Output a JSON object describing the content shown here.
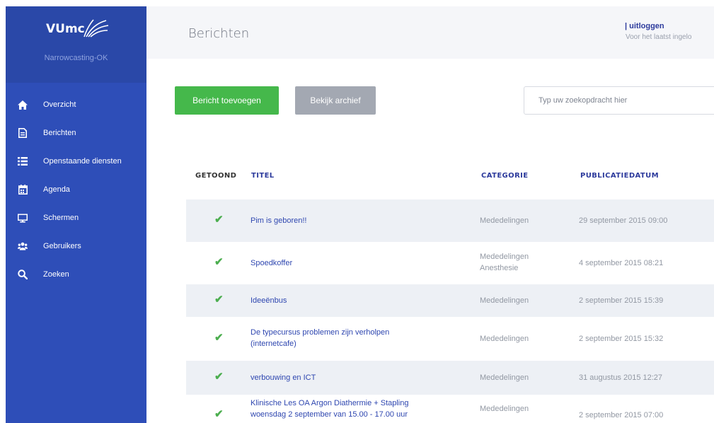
{
  "brand": {
    "logo_text": "VUmc",
    "subtitle": "Narrowcasting-OK"
  },
  "sidebar": {
    "items": [
      {
        "label": "Overzicht",
        "icon": "home-icon"
      },
      {
        "label": "Berichten",
        "icon": "document-icon"
      },
      {
        "label": "Openstaande diensten",
        "icon": "list-icon"
      },
      {
        "label": "Agenda",
        "icon": "calendar-icon"
      },
      {
        "label": "Schermen",
        "icon": "monitor-icon"
      },
      {
        "label": "Gebruikers",
        "icon": "users-icon"
      },
      {
        "label": "Zoeken",
        "icon": "search-icon"
      }
    ]
  },
  "header": {
    "title": "Berichten",
    "logout_label": "| uitloggen",
    "last_login_text": "Voor het laatst ingelo"
  },
  "toolbar": {
    "add_label": "Bericht toevoegen",
    "archive_label": "Bekijk archief",
    "search_placeholder": "Typ uw zoekopdracht hier"
  },
  "table": {
    "columns": {
      "shown": "GETOOND",
      "title": "TITEL",
      "category": "CATEGORIE",
      "date": "PUBLICATIEDATUM"
    },
    "rows": [
      {
        "shown": "✔",
        "title_lines": [
          "Pim is geboren!!"
        ],
        "category_lines": [
          "Mededelingen"
        ],
        "date": "29 september 2015 09:00"
      },
      {
        "shown": "✔",
        "title_lines": [
          "Spoedkoffer"
        ],
        "category_lines": [
          "Mededelingen",
          "Anesthesie"
        ],
        "date": "4 september 2015 08:21"
      },
      {
        "shown": "✔",
        "title_lines": [
          "Ideeënbus"
        ],
        "category_lines": [
          "Mededelingen"
        ],
        "date": "2 september 2015 15:39"
      },
      {
        "shown": "✔",
        "title_lines": [
          "De typecursus problemen zijn verholpen",
          "(internetcafe)"
        ],
        "category_lines": [
          "Mededelingen"
        ],
        "date": "2 september 2015 15:32"
      },
      {
        "shown": "✔",
        "title_lines": [
          "verbouwing en ICT"
        ],
        "category_lines": [
          "Mededelingen"
        ],
        "date": "31 augustus 2015 12:27"
      },
      {
        "shown": "✔",
        "title_lines": [
          "Klinische Les OA Argon Diathermie + Stapling",
          "woensdag 2 september van 15.00 - 17.00 uur"
        ],
        "category_lines": [
          "Mededelingen"
        ],
        "date": "2 september 2015 07:00"
      }
    ]
  },
  "colors": {
    "sidebar": "#2e4eb8",
    "accent_green": "#45b84b",
    "link_blue": "#2f47b0"
  }
}
